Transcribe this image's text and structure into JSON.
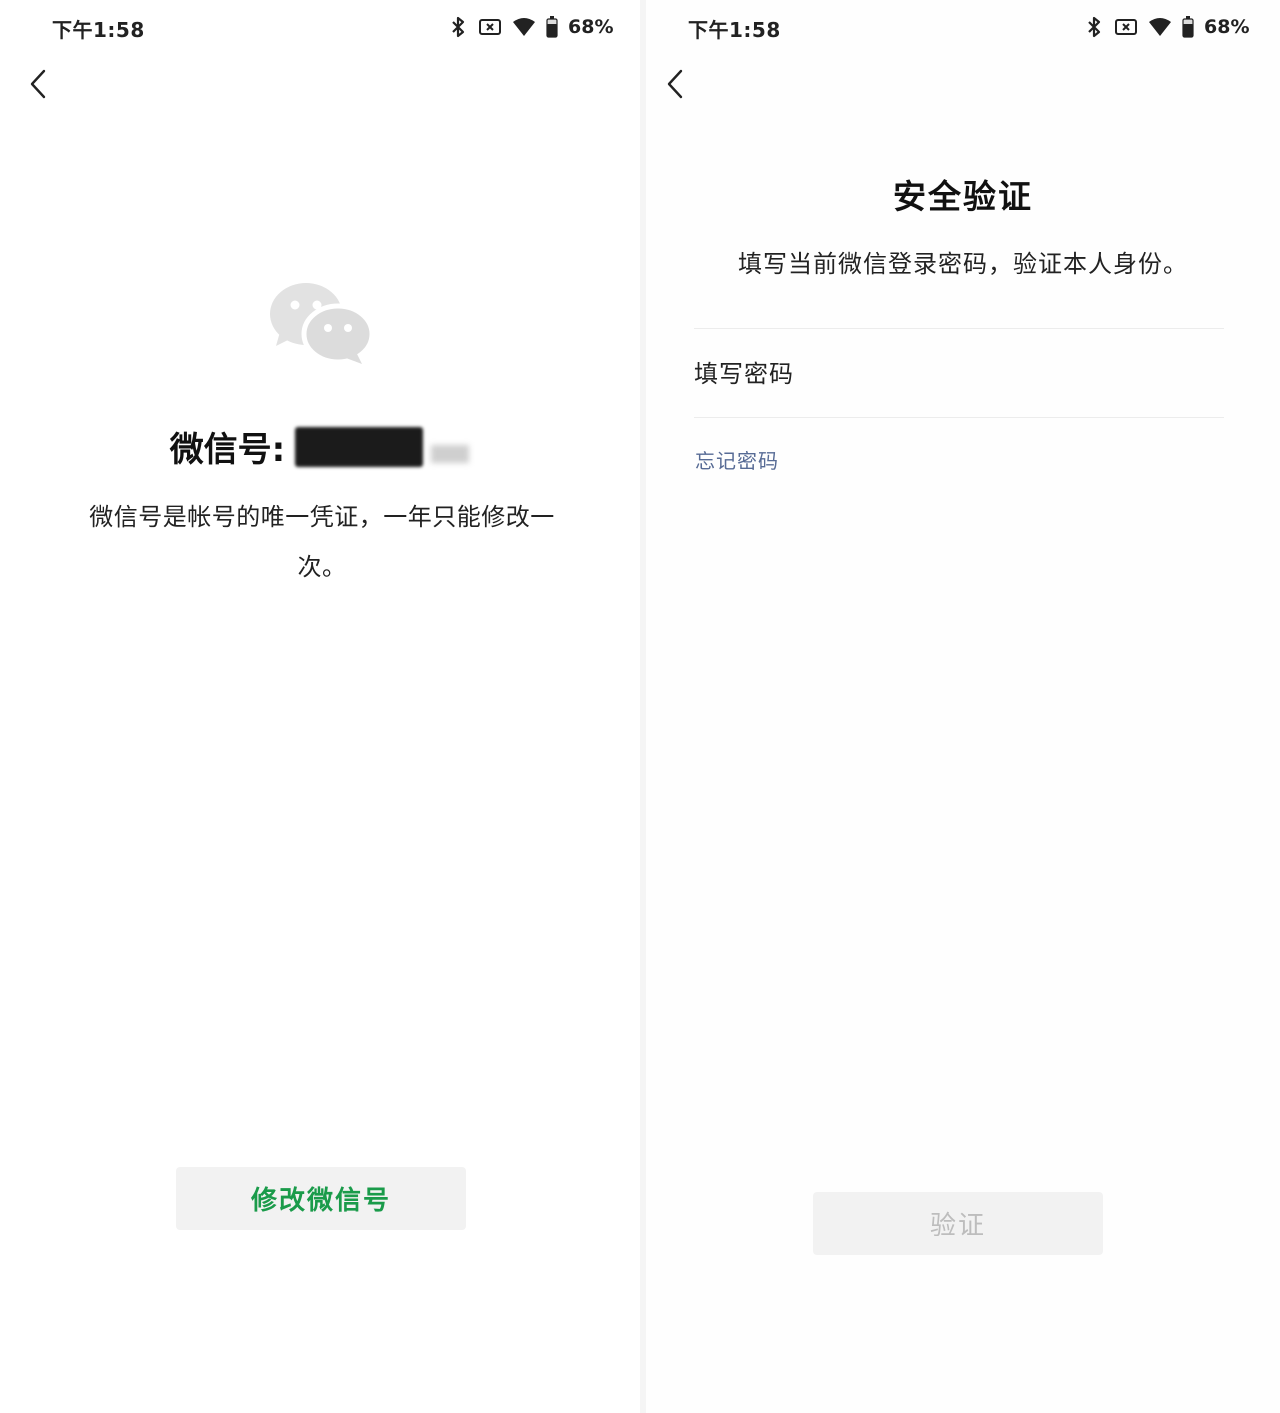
{
  "left_screen": {
    "status_bar": {
      "time": "下午1:58",
      "battery": "68%"
    },
    "wechat_id_label": "微信号:",
    "wechat_id_description": "微信号是帐号的唯一凭证，一年只能修改一次。",
    "modify_button_label": "修改微信号",
    "colors": {
      "accent": "#1a9b4a",
      "button_bg": "#f2f2f2"
    },
    "icons": [
      "back-arrow-icon",
      "wechat-logo-icon",
      "bluetooth-icon",
      "no-sim-icon",
      "wifi-icon",
      "battery-icon"
    ]
  },
  "right_screen": {
    "status_bar": {
      "time": "下午1:58",
      "battery": "68%"
    },
    "title": "安全验证",
    "description": "填写当前微信登录密码，验证本人身份。",
    "password_placeholder": "填写密码",
    "forgot_password_link": "忘记密码",
    "verify_button_label": "验证",
    "colors": {
      "link": "#576b95",
      "disabled_text": "#bdbdbd"
    },
    "icons": [
      "back-arrow-icon",
      "bluetooth-icon",
      "no-sim-icon",
      "wifi-icon",
      "battery-icon"
    ]
  }
}
